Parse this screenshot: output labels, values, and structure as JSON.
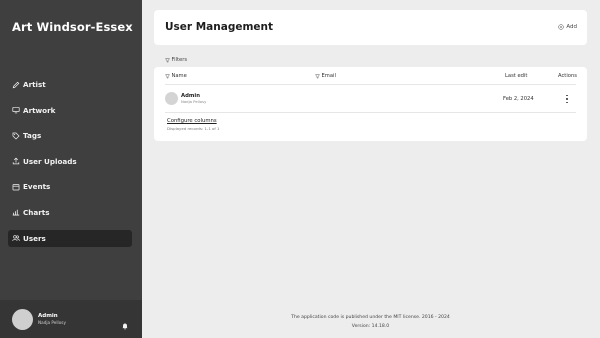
{
  "sidebar": {
    "brand": "Art Windsor-Essex",
    "items": [
      {
        "label": "Artist",
        "icon": "pencil-icon"
      },
      {
        "label": "Artwork",
        "icon": "monitor-icon"
      },
      {
        "label": "Tags",
        "icon": "tag-icon"
      },
      {
        "label": "User Uploads",
        "icon": "upload-icon"
      },
      {
        "label": "Events",
        "icon": "calendar-icon"
      },
      {
        "label": "Charts",
        "icon": "bar-chart-icon"
      },
      {
        "label": "Users",
        "icon": "users-icon",
        "active": true
      }
    ],
    "user": {
      "name": "Admin",
      "subtitle": "Nadja Pellosy"
    }
  },
  "header": {
    "title": "User Management",
    "add_label": "Add"
  },
  "filters_label": "Filters",
  "table": {
    "columns": {
      "name": "Name",
      "email": "Email",
      "last_edit": "Last edit",
      "actions": "Actions"
    },
    "rows": [
      {
        "name": "Admin",
        "subtitle": "Nadja Pellosy",
        "email": "",
        "last_edit": "Feb 2, 2024"
      }
    ],
    "configure_label": "Configure columns",
    "displayed_records": "Displayed records: 1-1 of 1"
  },
  "footer": {
    "license": "The application code is published under the MIT license. 2016 - 2024",
    "version": "Version: 14.18.0"
  },
  "colors": {
    "sidebar": "#3f3f3f",
    "active_item": "#262626",
    "background": "#ededed",
    "card": "#ffffff"
  }
}
